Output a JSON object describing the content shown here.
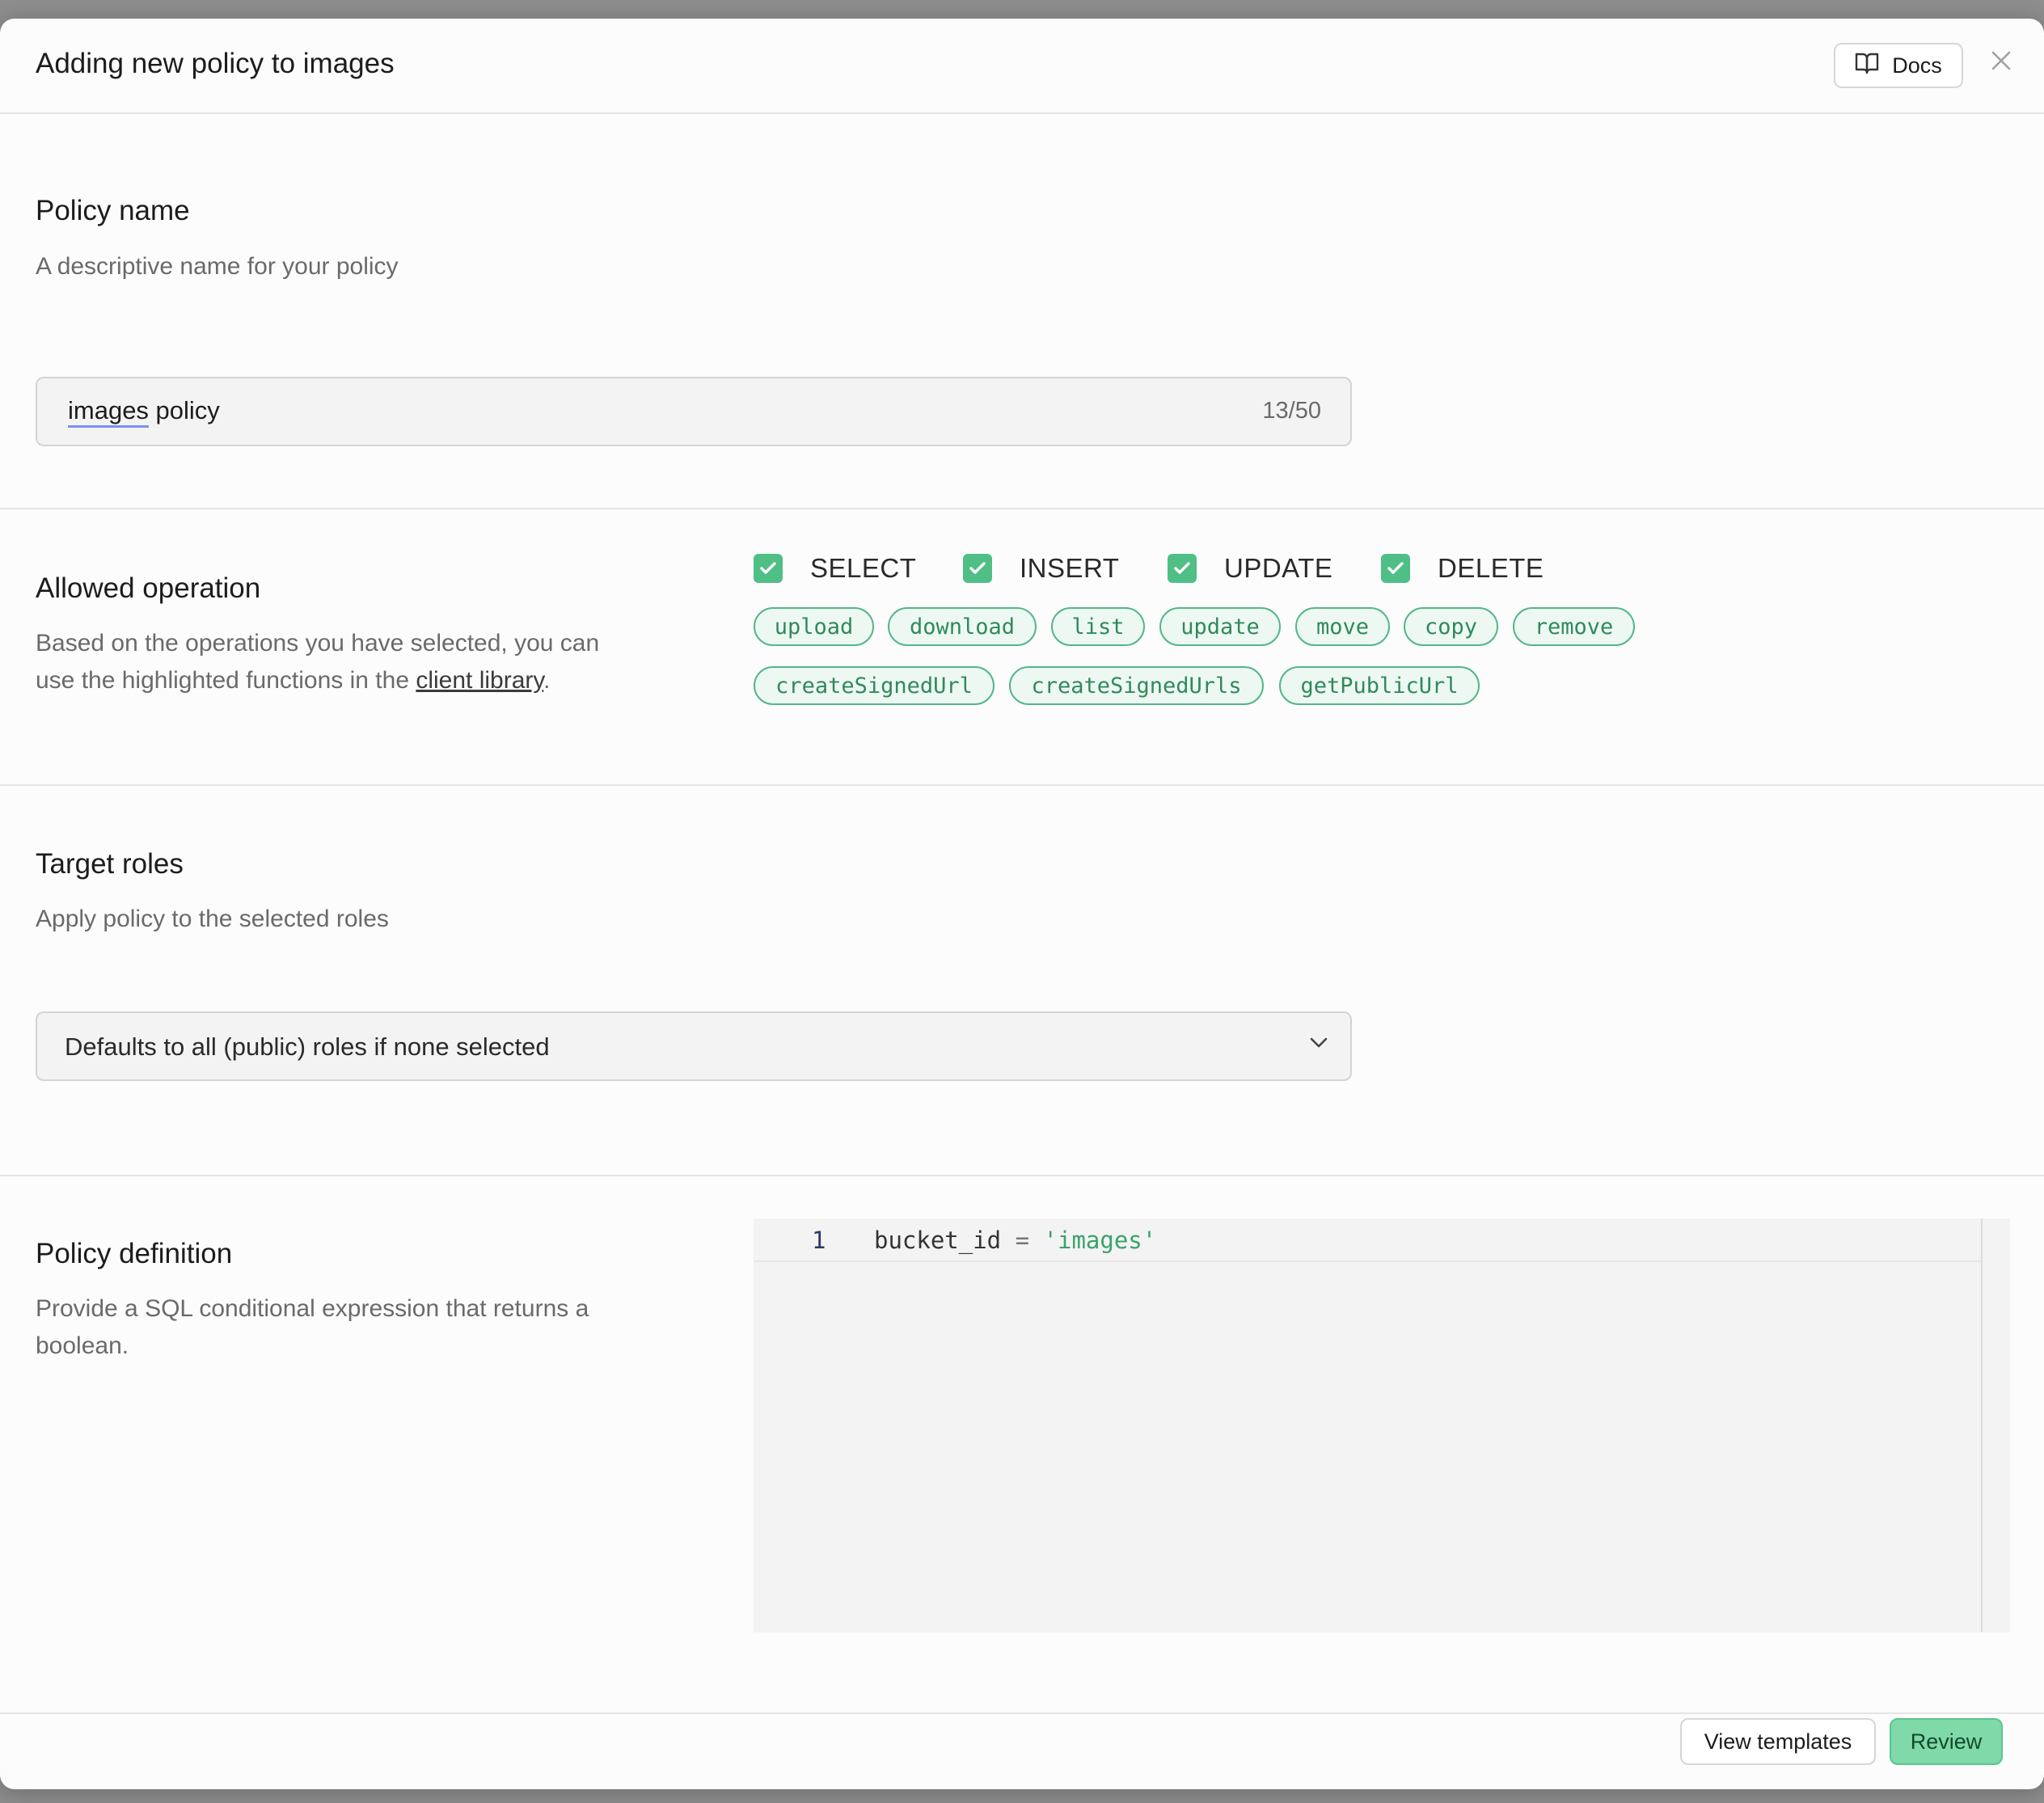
{
  "dialog": {
    "title": "Adding new policy to images",
    "docs_label": "Docs",
    "close_icon": "close-icon"
  },
  "policy_name": {
    "title": "Policy name",
    "description": "A descriptive name for your policy",
    "value_first_word": "images",
    "value_rest": " policy",
    "counter": "13/50"
  },
  "allowed_operation": {
    "title": "Allowed operation",
    "description_line1": "Based on the operations you have selected, you can",
    "description_line2_pre": "use the highlighted functions in the ",
    "description_link": "client library",
    "description_line2_post": ".",
    "operations": [
      {
        "label": "SELECT",
        "checked": true
      },
      {
        "label": "INSERT",
        "checked": true
      },
      {
        "label": "UPDATE",
        "checked": true
      },
      {
        "label": "DELETE",
        "checked": true
      }
    ],
    "functions": [
      "upload",
      "download",
      "list",
      "update",
      "move",
      "copy",
      "remove",
      "createSignedUrl",
      "createSignedUrls",
      "getPublicUrl"
    ]
  },
  "target_roles": {
    "title": "Target roles",
    "description": "Apply policy to the selected roles",
    "select_value": "Defaults to all (public) roles if none selected"
  },
  "policy_definition": {
    "title": "Policy definition",
    "description_line1": "Provide a SQL conditional expression that returns a",
    "description_line2": "boolean.",
    "line_number": "1",
    "code_ident": "bucket_id",
    "code_op": " = ",
    "code_string": "'images'"
  },
  "footer": {
    "view_templates_label": "View templates",
    "review_label": "Review"
  },
  "colors": {
    "accent": "#4fbf86",
    "review_bg": "#7fd9a8",
    "chip_border": "#52b788"
  }
}
